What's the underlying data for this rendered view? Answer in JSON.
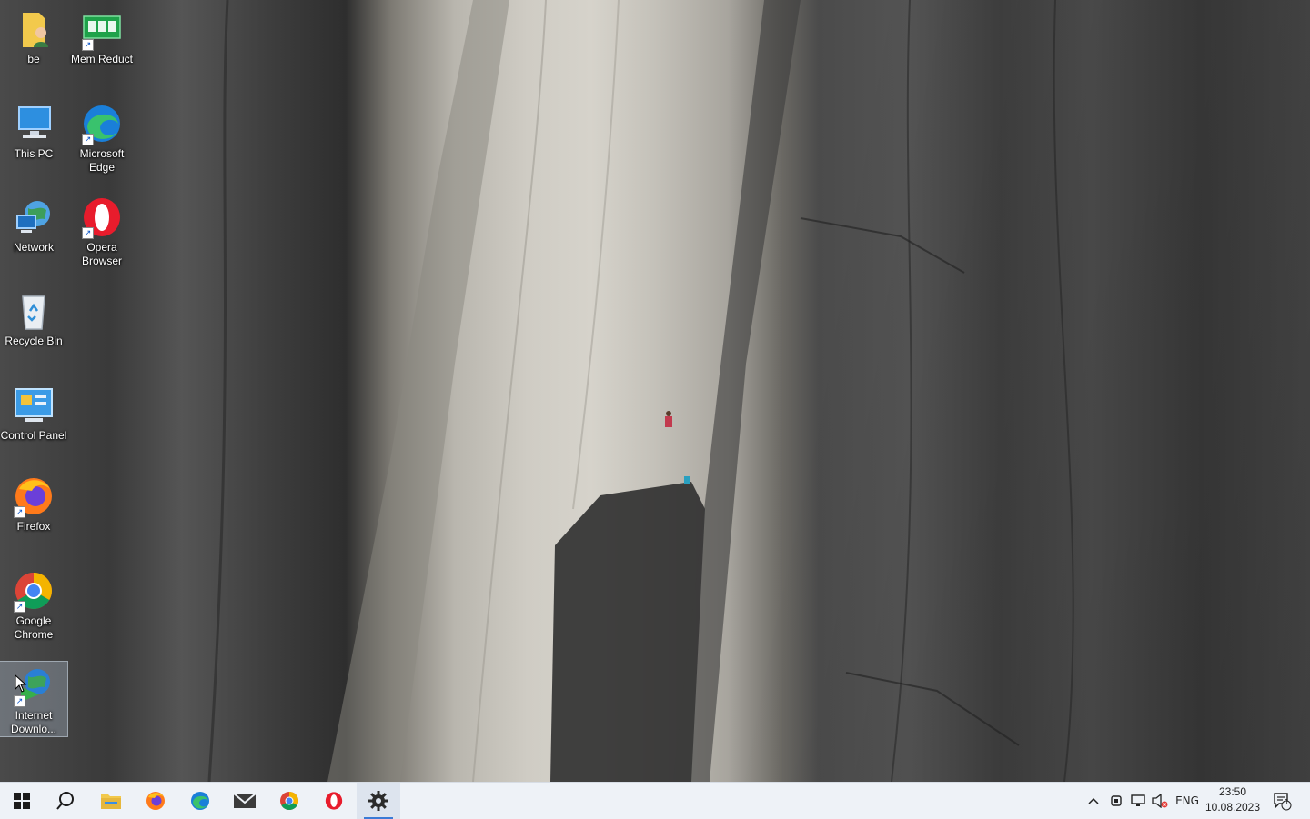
{
  "desktop": {
    "icons": [
      {
        "label": "be"
      },
      {
        "label": "Mem Reduct"
      },
      {
        "label": "This PC"
      },
      {
        "label": "Microsoft Edge"
      },
      {
        "label": "Network"
      },
      {
        "label": "Opera Browser"
      },
      {
        "label": "Recycle Bin"
      },
      {
        "label": "Control Panel"
      },
      {
        "label": "Firefox"
      },
      {
        "label": "Google Chrome"
      },
      {
        "label": "Internet Downlo..."
      }
    ]
  },
  "taskbar": {
    "pinned": [
      "start-icon",
      "search-icon",
      "file-explorer-icon",
      "firefox-icon",
      "edge-icon",
      "mail-icon",
      "chrome-icon",
      "opera-icon",
      "settings-icon"
    ],
    "active_app": "settings-icon",
    "tray": {
      "language": "ENG",
      "time": "23:50",
      "date": "10.08.2023",
      "notification_count": "1"
    }
  },
  "colors": {
    "taskbar_bg": "#eef2f7",
    "accent": "#3b7bd6"
  }
}
